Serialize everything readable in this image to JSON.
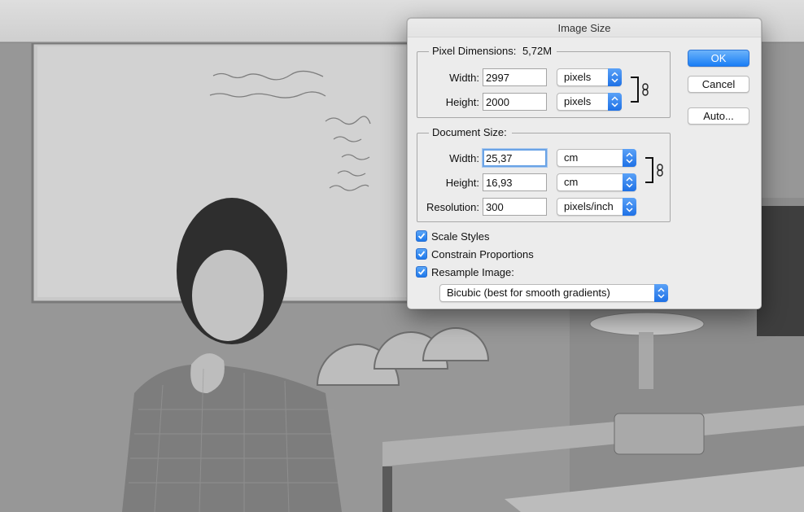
{
  "dialog": {
    "title": "Image Size",
    "pixel_dimensions": {
      "legend": "Pixel Dimensions:",
      "size": "5,72M",
      "width_label": "Width:",
      "width_value": "2997",
      "width_unit": "pixels",
      "height_label": "Height:",
      "height_value": "2000",
      "height_unit": "pixels"
    },
    "document_size": {
      "legend": "Document Size:",
      "width_label": "Width:",
      "width_value": "25,37",
      "width_unit": "cm",
      "height_label": "Height:",
      "height_value": "16,93",
      "height_unit": "cm",
      "resolution_label": "Resolution:",
      "resolution_value": "300",
      "resolution_unit": "pixels/inch"
    },
    "options": {
      "scale_styles": "Scale Styles",
      "constrain_proportions": "Constrain Proportions",
      "resample_image": "Resample Image:",
      "resample_method": "Bicubic (best for smooth gradients)"
    },
    "buttons": {
      "ok": "OK",
      "cancel": "Cancel",
      "auto": "Auto..."
    }
  },
  "colors": {
    "accent": "#1a7ef5",
    "dialog_bg": "#ececec"
  },
  "icons": [
    "chain-link-icon",
    "stepper-arrows-icon",
    "checkmark-icon"
  ]
}
